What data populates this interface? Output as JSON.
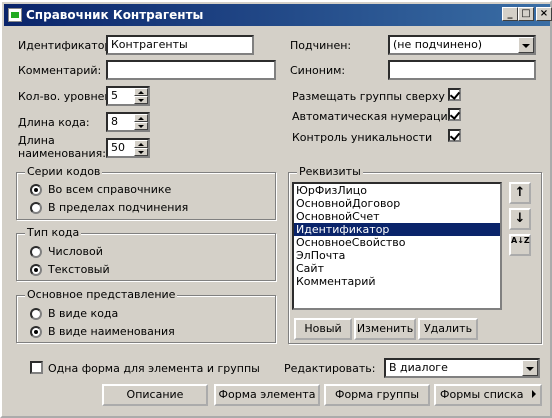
{
  "window": {
    "title": "Справочник Контрагенты",
    "min_label": "_",
    "max_label": "□",
    "close_label": "×"
  },
  "fields": {
    "id_label": "Идентификатор:",
    "id_value": "Контрагенты",
    "comment_label": "Комментарий:",
    "comment_value": "",
    "levels_label": "Кол-во. уровней:",
    "levels_value": "5",
    "code_len_label": "Длина кода:",
    "code_len_value": "8",
    "name_len_label1": "Длина",
    "name_len_label2": "наименования:",
    "name_len_value": "50",
    "subord_label": "Подчинен:",
    "subord_value": "(не подчинено)",
    "synonym_label": "Синоним:",
    "synonym_value": ""
  },
  "checks": {
    "groups_top": "Размещать группы сверху",
    "auto_num": "Автоматическая нумерация",
    "uniq": "Контроль уникальности",
    "one_form": "Одна форма для элемента и группы"
  },
  "series": {
    "caption": "Серии кодов",
    "opt1": "Во всем справочнике",
    "opt2": "В пределах подчинения"
  },
  "code_type": {
    "caption": "Тип кода",
    "opt1": "Числовой",
    "opt2": "Текстовый"
  },
  "repr": {
    "caption": "Основное представление",
    "opt1": "В виде кода",
    "opt2": "В виде наименования"
  },
  "requisites": {
    "caption": "Реквизиты",
    "items": [
      "ЮрФизЛицо",
      "ОсновнойДоговор",
      "ОсновнойСчет",
      "Идентификатор",
      "ОсновноеСвойство",
      "ЭлПочта",
      "Сайт",
      "Комментарий"
    ],
    "new": "Новый",
    "edit": "Изменить",
    "delete": "Удалить",
    "up_icon": "↑",
    "down_icon": "↓",
    "sort_icon": "A↓Z"
  },
  "edit_mode": {
    "label": "Редактировать:",
    "value": "В диалоге"
  },
  "bottom": {
    "desc": "Описание",
    "elem_form": "Форма элемента",
    "group_form": "Форма группы",
    "list_forms": "Формы списка"
  }
}
